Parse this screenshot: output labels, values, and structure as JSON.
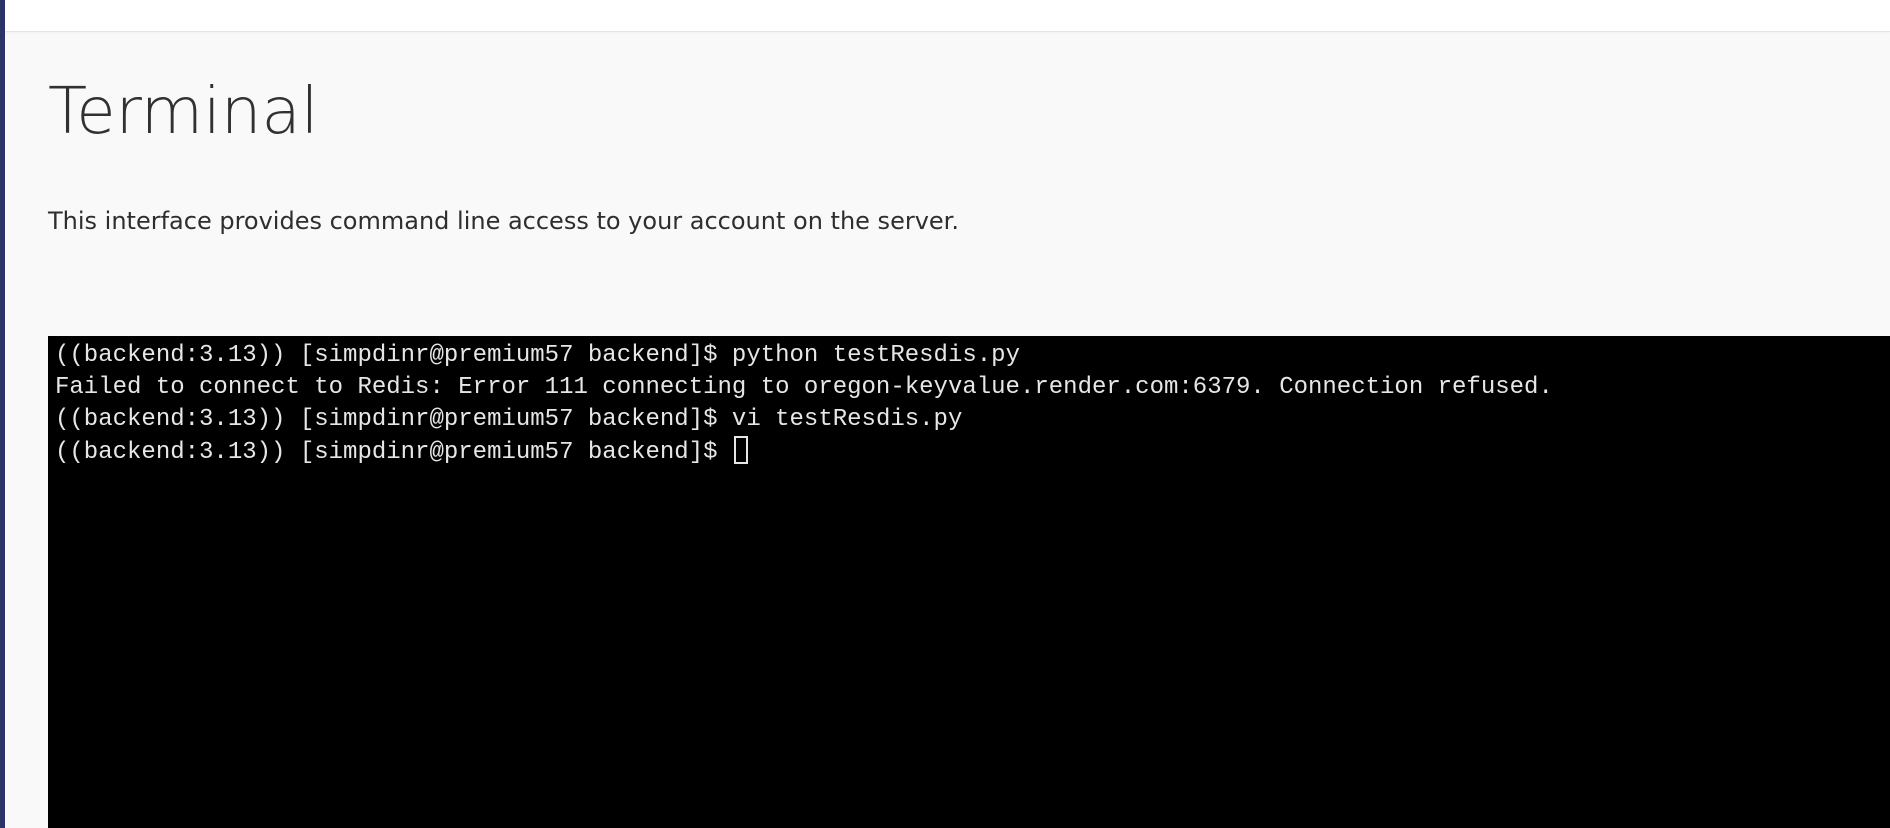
{
  "page": {
    "title": "Terminal",
    "description": "This interface provides command line access to your account on the server."
  },
  "terminal": {
    "lines": [
      {
        "prompt": "((backend:3.13)) [simpdinr@premium57 backend]$ ",
        "command": "python testResdis.py"
      },
      {
        "output": "Failed to connect to Redis: Error 111 connecting to oregon-keyvalue.render.com:6379. Connection refused."
      },
      {
        "prompt": "((backend:3.13)) [simpdinr@premium57 backend]$ ",
        "command": "vi testResdis.py"
      },
      {
        "prompt": "((backend:3.13)) [simpdinr@premium57 backend]$ ",
        "command": ""
      }
    ]
  },
  "colors": {
    "rail": "#2a3466",
    "background": "#f9f9f9",
    "terminal_bg": "#000000",
    "terminal_fg": "#e6e6e6"
  }
}
